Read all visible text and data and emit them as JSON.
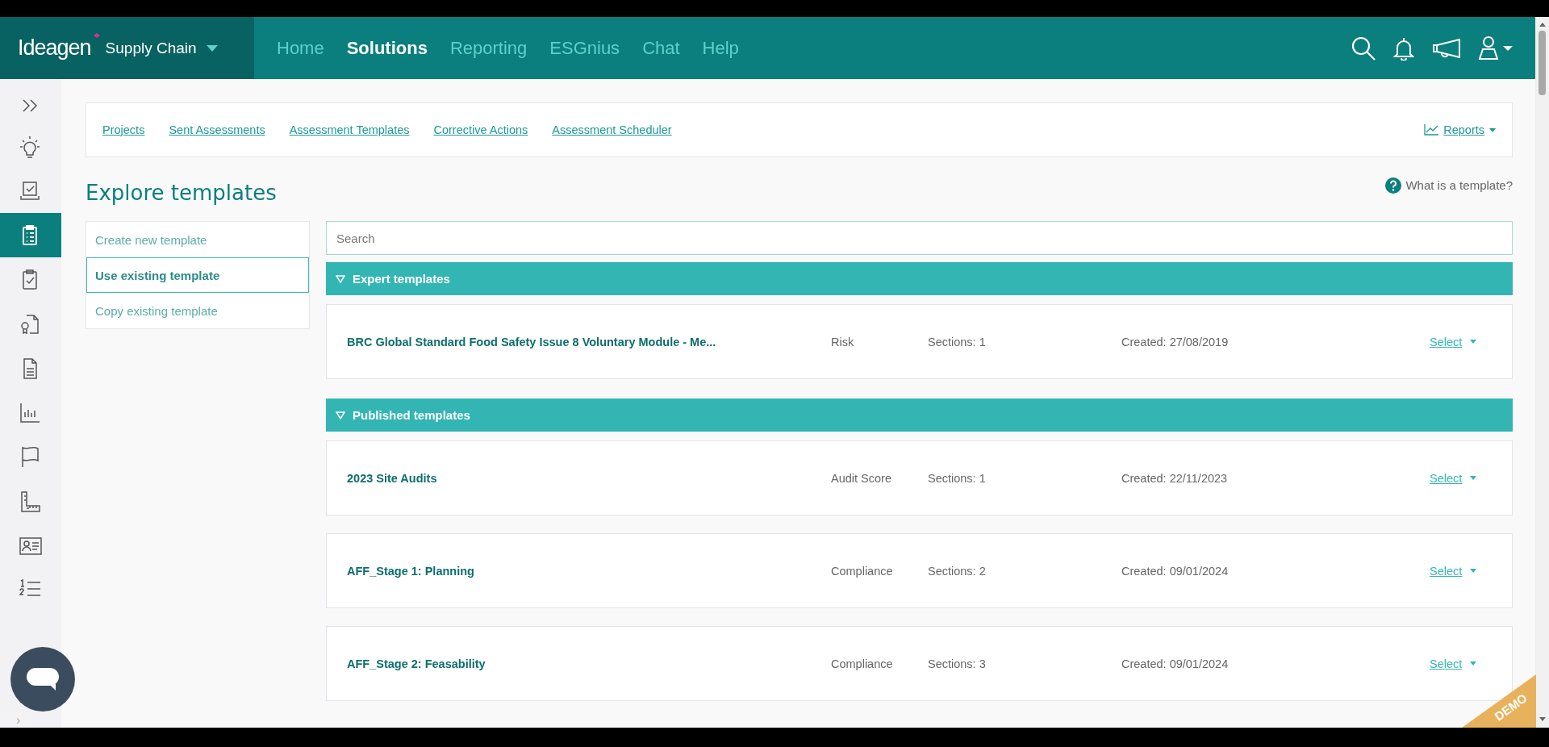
{
  "header": {
    "brand": "Ideagen",
    "product": "Supply Chain",
    "nav": [
      {
        "label": "Home",
        "selected": false
      },
      {
        "label": "Solutions",
        "selected": true
      },
      {
        "label": "Reporting",
        "selected": false
      },
      {
        "label": "ESGnius",
        "selected": false
      },
      {
        "label": "Chat",
        "selected": false
      },
      {
        "label": "Help",
        "selected": false
      }
    ]
  },
  "sidebar": {
    "items": [
      {
        "selected": false
      },
      {
        "selected": false
      },
      {
        "selected": true
      },
      {
        "selected": false
      },
      {
        "selected": false
      },
      {
        "selected": false
      },
      {
        "selected": false
      },
      {
        "selected": false
      },
      {
        "selected": false
      },
      {
        "selected": false
      },
      {
        "selected": false
      }
    ]
  },
  "subnav": {
    "links": [
      "Projects",
      "Sent Assessments",
      "Assessment Templates",
      "Corrective Actions",
      "Assessment Scheduler"
    ],
    "reports": "Reports"
  },
  "page": {
    "title": "Explore templates",
    "help": "What is a template?"
  },
  "options": [
    {
      "label": "Create new template",
      "selected": false
    },
    {
      "label": "Use existing template",
      "selected": true
    },
    {
      "label": "Copy existing template",
      "selected": false
    }
  ],
  "search": {
    "placeholder": "Search"
  },
  "sections": [
    {
      "title": "Expert templates",
      "expanded": true,
      "templates": [
        {
          "name": "BRC Global Standard Food Safety Issue 8 Voluntary Module - Me...",
          "type": "Risk",
          "sections": "Sections: 1",
          "created": "Created: 27/08/2019",
          "action": "Select"
        }
      ]
    },
    {
      "title": "Published templates",
      "expanded": true,
      "templates": [
        {
          "name": "2023 Site Audits",
          "type": "Audit Score",
          "sections": "Sections: 1",
          "created": "Created: 22/11/2023",
          "action": "Select"
        },
        {
          "name": "AFF_Stage 1: Planning",
          "type": "Compliance",
          "sections": "Sections: 2",
          "created": "Created: 09/01/2024",
          "action": "Select"
        },
        {
          "name": "AFF_Stage 2: Feasability",
          "type": "Compliance",
          "sections": "Sections: 3",
          "created": "Created: 09/01/2024",
          "action": "Select"
        }
      ]
    }
  ],
  "demo_badge": "DEMO",
  "chat": {
    "tab": "›"
  }
}
